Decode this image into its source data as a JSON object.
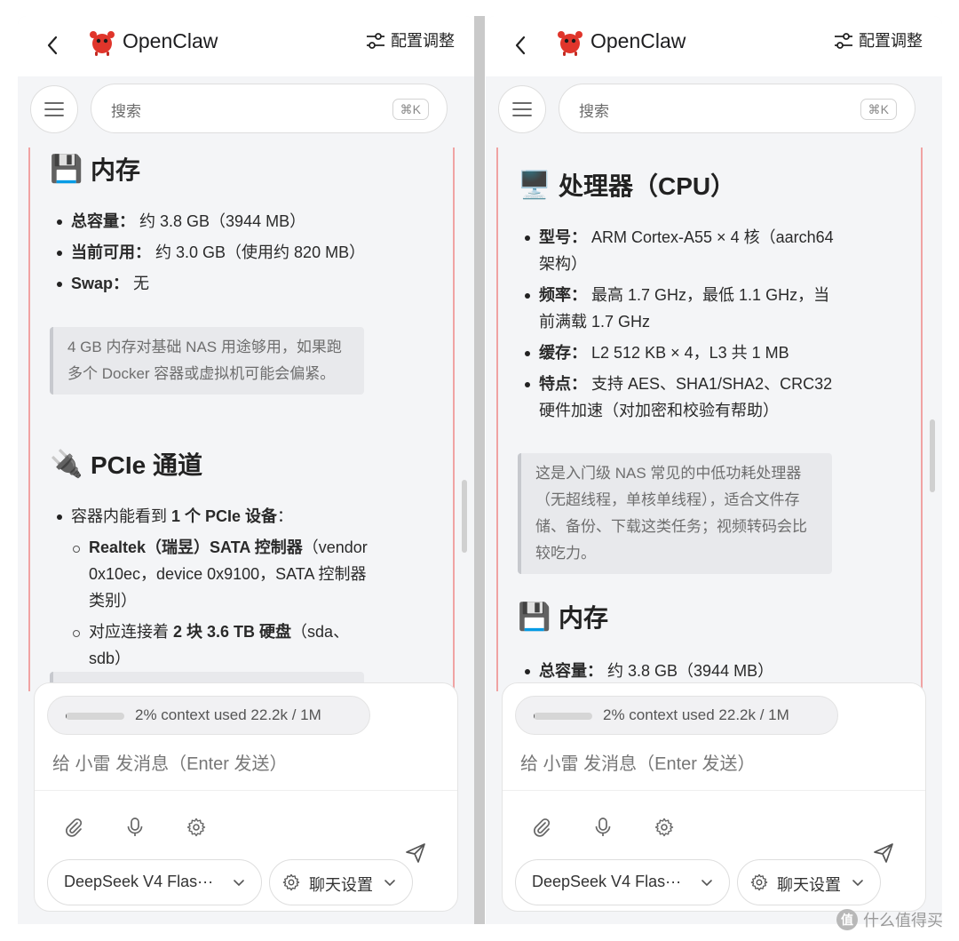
{
  "header": {
    "app_title": "OpenClaw",
    "config_label": "配置调整"
  },
  "search": {
    "placeholder": "搜索",
    "shortcut": "⌘K"
  },
  "left": {
    "memory": {
      "title": "内存",
      "items": [
        {
          "key": "总容量：",
          "value": "约 3.8 GB（3944 MB）"
        },
        {
          "key": "当前可用：",
          "value": "约 3.0 GB（使用约 820 MB）"
        },
        {
          "key": "Swap：",
          "value": "无"
        }
      ],
      "note": "4 GB 内存对基础 NAS 用途够用，如果跑多个 Docker 容器或虚拟机可能会偏紧。"
    },
    "pcie": {
      "title": "PCIe 通道",
      "item_pre": "容器内能看到",
      "item_bold": "1 个 PCIe 设备",
      "item_post": "：",
      "sub1_bold": "Realtek（瑞昱）SATA 控制器",
      "sub1_rest": "（vendor 0x10ec，device 0x9100，SATA 控制器类别）",
      "sub2_pre": "对应连接着",
      "sub2_bold": "2 块 3.6 TB 硬盘",
      "sub2_rest": "（sda、sdb）"
    }
  },
  "right": {
    "cpu": {
      "title": "处理器（CPU）",
      "items": [
        {
          "key": "型号：",
          "value": "ARM Cortex-A55 × 4 核（aarch64 架构）"
        },
        {
          "key": "频率：",
          "value": "最高 1.7 GHz，最低 1.1 GHz，当前满载 1.7 GHz"
        },
        {
          "key": "缓存：",
          "value": "L2 512 KB × 4，L3 共 1 MB"
        },
        {
          "key": "特点：",
          "value": "支持 AES、SHA1/SHA2、CRC32 硬件加速（对加密和校验有帮助）"
        }
      ],
      "note": "这是入门级 NAS 常见的中低功耗处理器（无超线程，单核单线程），适合文件存储、备份、下载这类任务；视频转码会比较吃力。"
    },
    "memory": {
      "title": "内存",
      "first_key": "总容量：",
      "first_value": "约 3.8 GB（3944 MB）"
    }
  },
  "composer": {
    "context_text": "2% context used  22.2k / 1M",
    "context_fraction": 0.02,
    "placeholder": "给 小雷 发消息（Enter 发送）",
    "model": "DeepSeek V4 Flash",
    "model_display": "DeepSeek V4 Flas···",
    "chat_settings": "聊天设置"
  },
  "watermark": {
    "badge": "值",
    "text": "什么值得买"
  },
  "colors": {
    "accent_border": "#f0a3a3",
    "logo_red": "#e0352b"
  },
  "icons": [
    "back-icon",
    "crab-logo-icon",
    "sliders-icon",
    "hamburger-icon",
    "floppy-disk-icon",
    "plug-icon",
    "computer-icon",
    "paperclip-icon",
    "microphone-icon",
    "gear-icon",
    "send-icon",
    "chevron-down-icon"
  ]
}
